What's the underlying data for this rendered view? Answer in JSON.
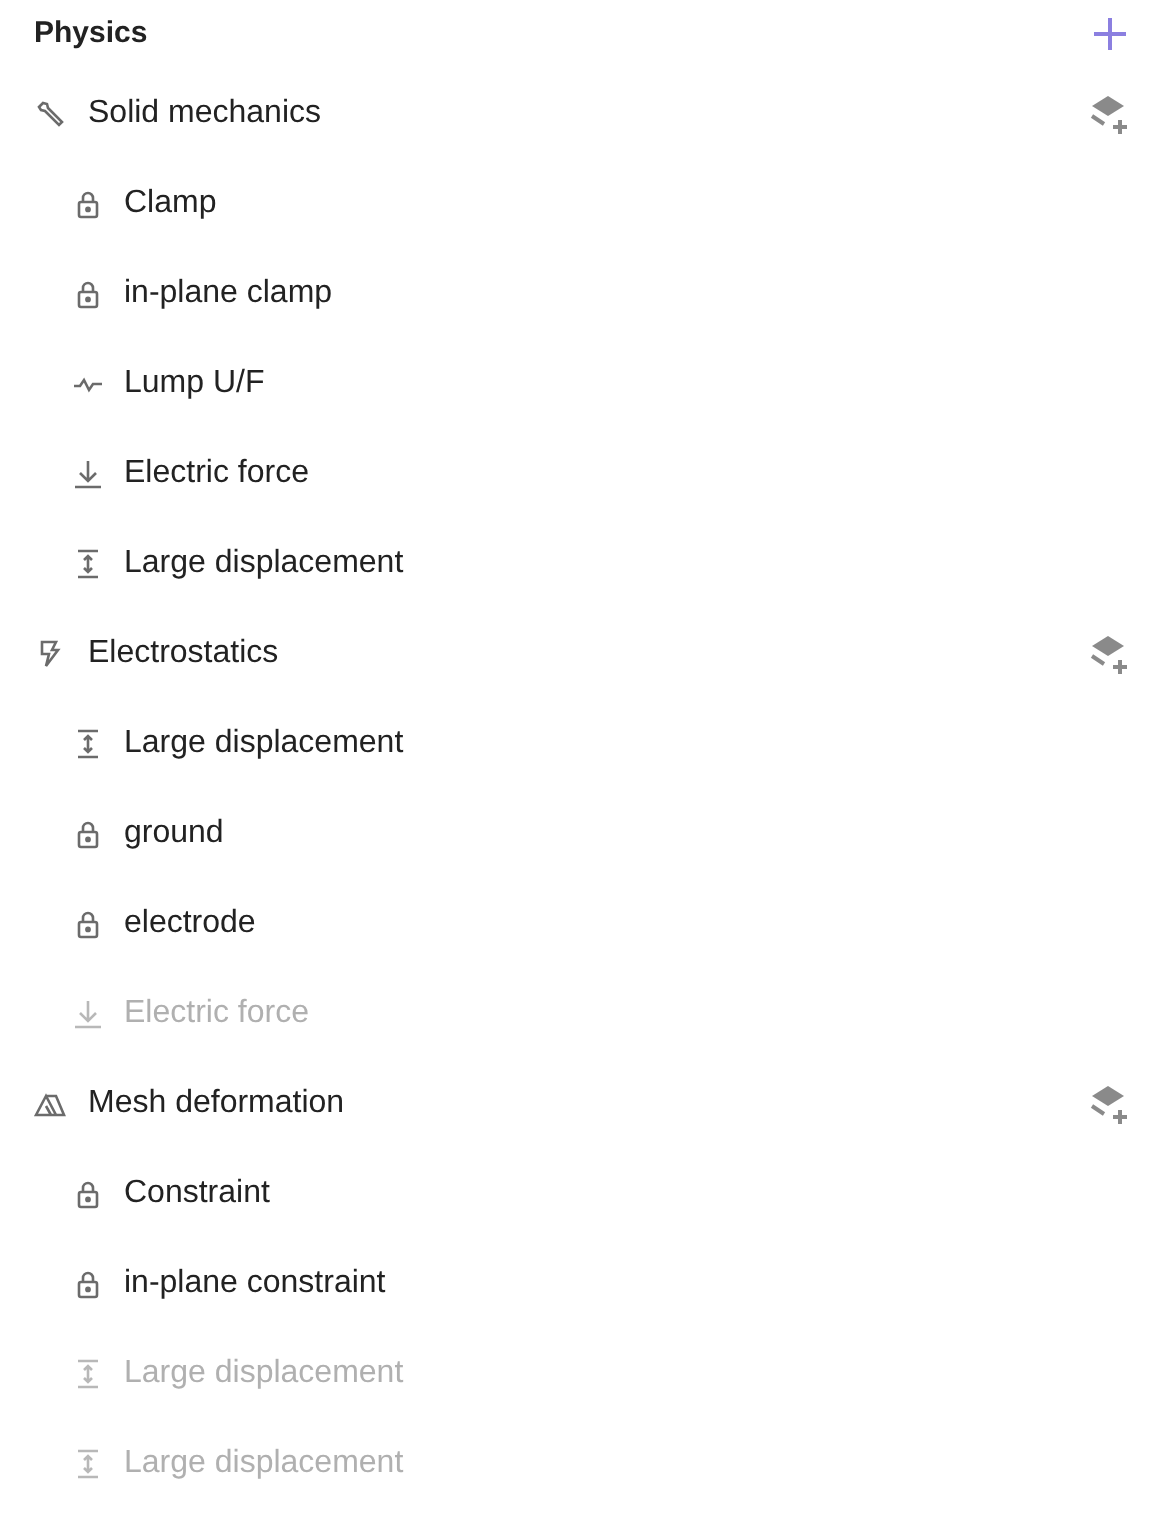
{
  "title": "Physics",
  "groups": [
    {
      "name": "Solid mechanics",
      "kind": "wrench",
      "children": [
        {
          "label": "Clamp",
          "kind": "lock",
          "disabled": false
        },
        {
          "label": "in-plane clamp",
          "kind": "lock",
          "disabled": false
        },
        {
          "label": "Lump U/F",
          "kind": "wave",
          "disabled": false
        },
        {
          "label": "Electric force",
          "kind": "arrow",
          "disabled": false
        },
        {
          "label": "Large displacement",
          "kind": "displacement",
          "disabled": false
        }
      ]
    },
    {
      "name": "Electrostatics",
      "kind": "bolt",
      "children": [
        {
          "label": "Large displacement",
          "kind": "displacement",
          "disabled": false
        },
        {
          "label": "ground",
          "kind": "lock",
          "disabled": false
        },
        {
          "label": "electrode",
          "kind": "lock",
          "disabled": false
        },
        {
          "label": "Electric force",
          "kind": "arrow",
          "disabled": true
        }
      ]
    },
    {
      "name": "Mesh deformation",
      "kind": "mesh",
      "children": [
        {
          "label": "Constraint",
          "kind": "lock",
          "disabled": false
        },
        {
          "label": "in-plane constraint",
          "kind": "lock",
          "disabled": false
        },
        {
          "label": "Large displacement",
          "kind": "displacement",
          "disabled": true
        },
        {
          "label": "Large displacement",
          "kind": "displacement",
          "disabled": true
        }
      ]
    }
  ]
}
